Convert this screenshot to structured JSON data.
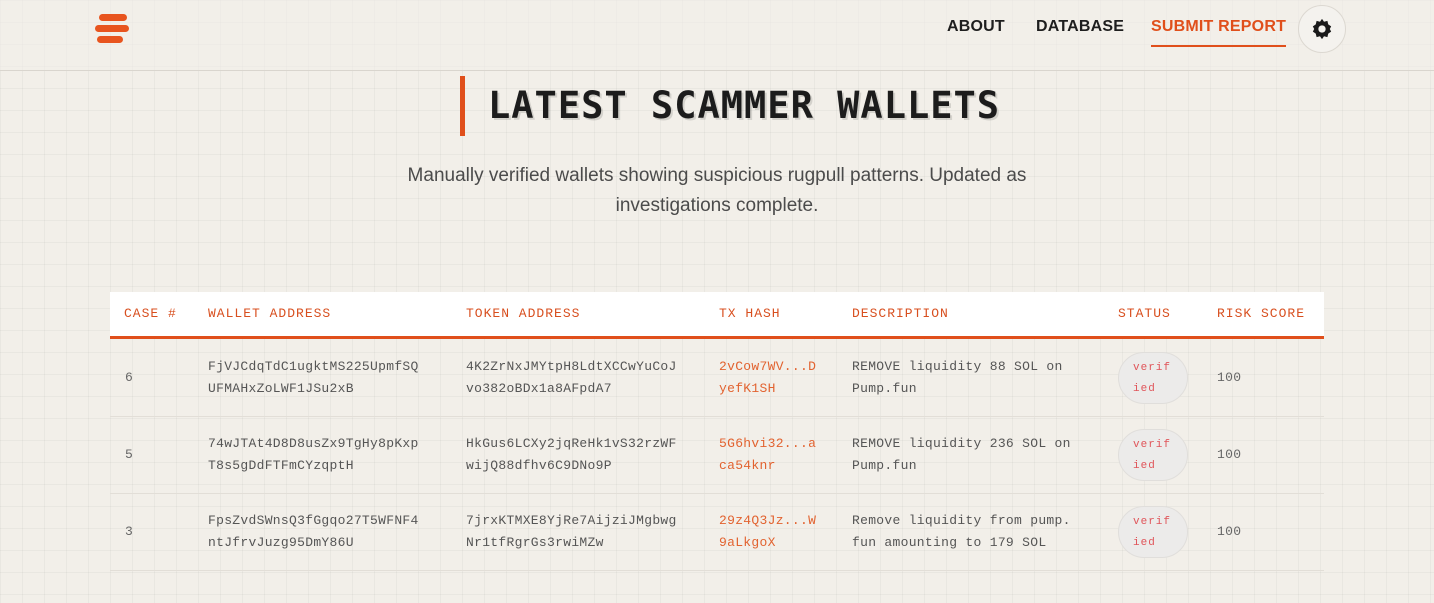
{
  "nav": {
    "about": "ABOUT",
    "database": "DATABASE",
    "submit_report": "SUBMIT REPORT"
  },
  "page": {
    "title": "LATEST SCAMMER WALLETS",
    "subtitle_line1": "Manually verified wallets showing suspicious rugpull patterns. Updated as",
    "subtitle_line2": "investigations complete."
  },
  "table": {
    "headers": [
      "CASE #",
      "WALLET ADDRESS",
      "TOKEN ADDRESS",
      "TX HASH",
      "DESCRIPTION",
      "STATUS",
      "RISK SCORE"
    ],
    "rows": [
      {
        "case": "6",
        "wallet": [
          "FjVJCdqTdC1ugktMS225UpmfSQ",
          "UFMAHxZoLWF1JSu2xB"
        ],
        "token": [
          "4K2ZrNxJMYtpH8LdtXCCwYuCoJ",
          "vo382oBDx1a8AFpdA7"
        ],
        "tx": [
          "2vCow7WV...D",
          "yefK1SH"
        ],
        "description": [
          "REMOVE liquidity 88 SOL on",
          "Pump.fun"
        ],
        "status": [
          "verif",
          "ied"
        ],
        "risk": "100"
      },
      {
        "case": "5",
        "wallet": [
          "74wJTAt4D8D8usZx9TgHy8pKxp",
          "T8s5gDdFTFmCYzqptH"
        ],
        "token": [
          "HkGus6LCXy2jqReHk1vS32rzWF",
          "wijQ88dfhv6C9DNo9P"
        ],
        "tx": [
          "5G6hvi32...a",
          "ca54knr"
        ],
        "description": [
          "REMOVE liquidity 236 SOL on",
          "Pump.fun"
        ],
        "status": [
          "verif",
          "ied"
        ],
        "risk": "100"
      },
      {
        "case": "3",
        "wallet": [
          "FpsZvdSWnsQ3fGgqo27T5WFNF4",
          "ntJfrvJuzg95DmY86U"
        ],
        "token": [
          "7jrxKTMXE8YjRe7AijziJMgbwg",
          "Nr1tfRgrGs3rwiMZw"
        ],
        "tx": [
          "29z4Q3Jz...W",
          "9aLkgoX"
        ],
        "description": [
          "Remove liquidity from pump.",
          "fun amounting to 179 SOL"
        ],
        "status": [
          "verif",
          "ied"
        ],
        "risk": "100"
      }
    ]
  },
  "colors": {
    "accent": "#e04f1b",
    "background": "#f2efe9",
    "status_text": "#e0555a"
  },
  "icons": {
    "logo": "menu-logo-icon",
    "theme": "gear-icon"
  }
}
